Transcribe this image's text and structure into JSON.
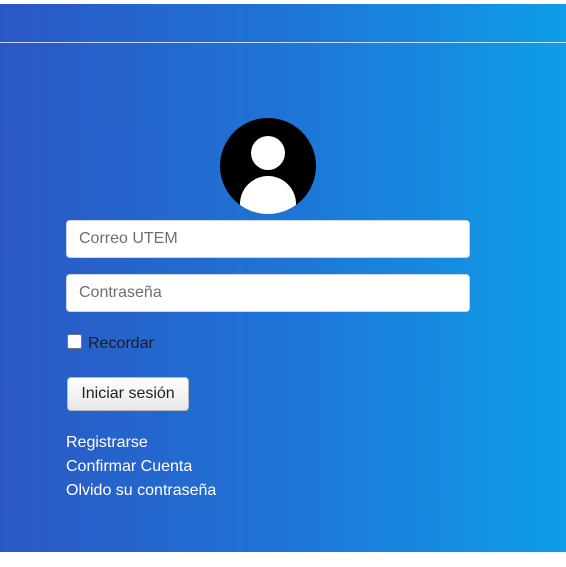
{
  "login": {
    "email_placeholder": "Correo UTEM",
    "password_placeholder": "Contraseña",
    "remember_label": "Recordar",
    "submit_label": "Iniciar sesión",
    "avatar_icon": "user-circle-icon",
    "links": [
      {
        "label": "Registrarse"
      },
      {
        "label": "Confirmar Cuenta"
      },
      {
        "label": "Olvido su contraseña"
      }
    ]
  },
  "colors": {
    "gradient_start": "#2b57c4",
    "gradient_mid": "#1f74d6",
    "gradient_end": "#0e9de8",
    "link_text": "#ffffff"
  }
}
